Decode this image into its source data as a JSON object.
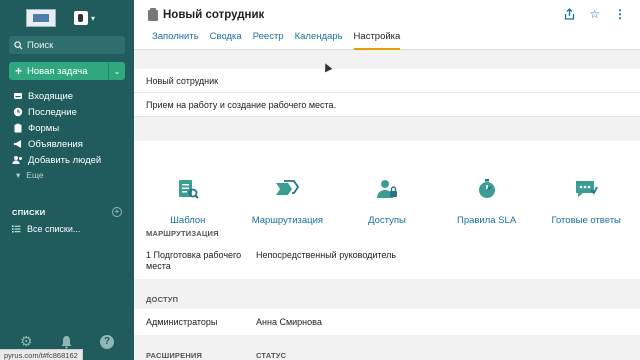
{
  "sidebar": {
    "search_label": "Поиск",
    "new_task_label": "Новая задача",
    "nav": [
      {
        "label": "Входящие",
        "icon": "inbox-icon"
      },
      {
        "label": "Последние",
        "icon": "clock-icon"
      },
      {
        "label": "Формы",
        "icon": "clipboard-icon"
      },
      {
        "label": "Объявления",
        "icon": "megaphone-icon"
      },
      {
        "label": "Добавить людей",
        "icon": "add-people-icon"
      }
    ],
    "more_label": "Еще",
    "lists_heading": "СПИСКИ",
    "all_lists_label": "Все списки..."
  },
  "status_url": "pyrus.com/t#fc868162",
  "header": {
    "title": "Новый сотрудник",
    "tabs": [
      "Заполнить",
      "Сводка",
      "Реестр",
      "Календарь",
      "Настройка"
    ],
    "active_tab": "Настройка"
  },
  "form": {
    "name_value": "Новый сотрудник",
    "description_value": "Прием на работу и создание рабочего места."
  },
  "cards": [
    {
      "label": "Шаблон",
      "icon": "template-icon"
    },
    {
      "label": "Маршрутизация",
      "icon": "routing-icon"
    },
    {
      "label": "Доступы",
      "icon": "access-icon"
    },
    {
      "label": "Правила SLA",
      "icon": "sla-timer-icon"
    },
    {
      "label": "Готовые ответы",
      "icon": "ready-replies-icon"
    }
  ],
  "routing": {
    "heading": "МАРШРУТИЗАЦИЯ",
    "step": "1 Подготовка рабочего места",
    "assignee": "Непосредственный руководитель"
  },
  "access": {
    "heading": "ДОСТУП",
    "role": "Администраторы",
    "person": "Анна Смирнова"
  },
  "extensions": {
    "heading": "РАСШИРЕНИЯ",
    "status_heading": "СТАТУС"
  },
  "colors": {
    "sidebar_bg": "#1f5c5b",
    "accent_green": "#2fa87f",
    "link_blue": "#1a6fa0",
    "icon_teal": "#3a9e93",
    "tab_underline": "#e0a000"
  }
}
